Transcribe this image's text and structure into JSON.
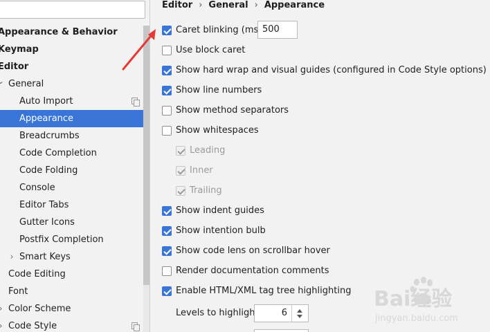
{
  "breadcrumb": {
    "items": [
      "Editor",
      "General",
      "Appearance"
    ],
    "separator": "›"
  },
  "search": {
    "value": ""
  },
  "tree": [
    {
      "label": "Appearance & Behavior",
      "bold": true
    },
    {
      "label": "Keymap",
      "bold": true
    },
    {
      "label": "Editor",
      "bold": true
    },
    {
      "label": "General",
      "expanded": true
    },
    {
      "label": "Auto Import",
      "has_icon": true
    },
    {
      "label": "Appearance",
      "selected": true
    },
    {
      "label": "Breadcrumbs"
    },
    {
      "label": "Code Completion"
    },
    {
      "label": "Code Folding"
    },
    {
      "label": "Console"
    },
    {
      "label": "Editor Tabs"
    },
    {
      "label": "Gutter Icons"
    },
    {
      "label": "Postfix Completion"
    },
    {
      "label": "Smart Keys",
      "collapsed": true
    },
    {
      "label": "Code Editing"
    },
    {
      "label": "Font"
    },
    {
      "label": "Color Scheme",
      "collapsed": true
    },
    {
      "label": "Code Style",
      "collapsed": true,
      "has_icon": true
    }
  ],
  "options": [
    {
      "label": "Caret blinking (ms):",
      "checked": true
    },
    {
      "label": "Use block caret",
      "checked": false
    },
    {
      "label": "Show hard wrap and visual guides (configured in Code Style options)",
      "checked": true
    },
    {
      "label": "Show line numbers",
      "checked": true
    },
    {
      "label": "Show method separators",
      "checked": false
    },
    {
      "label": "Show whitespaces",
      "checked": false
    },
    {
      "label": "Leading",
      "checked": true,
      "disabled": true
    },
    {
      "label": "Inner",
      "checked": true,
      "disabled": true
    },
    {
      "label": "Trailing",
      "checked": true,
      "disabled": true
    },
    {
      "label": "Show indent guides",
      "checked": true
    },
    {
      "label": "Show intention bulb",
      "checked": true
    },
    {
      "label": "Show code lens on scrollbar hover",
      "checked": true
    },
    {
      "label": "Render documentation comments",
      "checked": false
    },
    {
      "label": "Enable HTML/XML tag tree highlighting",
      "checked": true
    }
  ],
  "caret_blinking": {
    "value": "500"
  },
  "levels": {
    "label": "Levels to highlight:",
    "value": "6"
  },
  "colors": {
    "selection": "#3875d7",
    "annotation_arrow": "#e53935"
  },
  "watermark": {
    "text": "Bai经验",
    "url": "jingyan.baidu.com"
  }
}
